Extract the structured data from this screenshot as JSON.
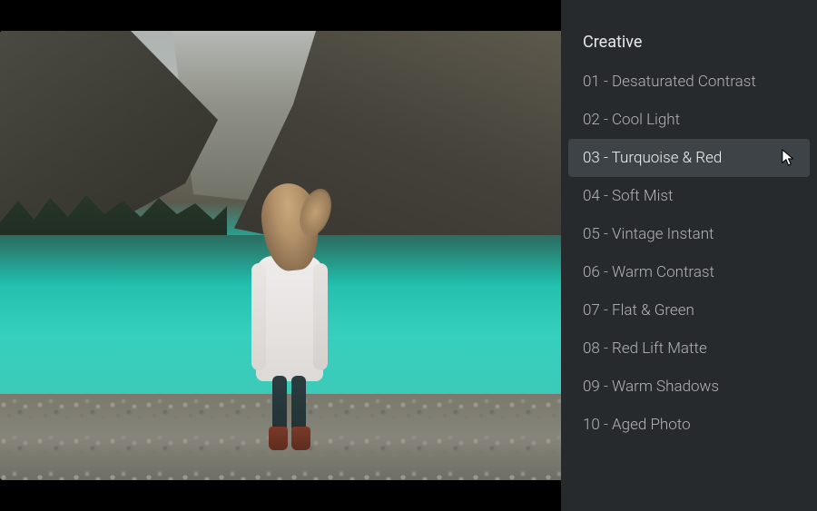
{
  "panel": {
    "title": "Creative",
    "hoveredIndex": 2,
    "presets": [
      {
        "label": "01 - Desaturated Contrast"
      },
      {
        "label": "02 - Cool Light"
      },
      {
        "label": "03 - Turquoise & Red"
      },
      {
        "label": "04 - Soft Mist"
      },
      {
        "label": "05 - Vintage Instant"
      },
      {
        "label": "06 - Warm Contrast"
      },
      {
        "label": "07 - Flat & Green"
      },
      {
        "label": "08 - Red Lift Matte"
      },
      {
        "label": "09 - Warm Shadows"
      },
      {
        "label": "10 - Aged Photo"
      }
    ]
  }
}
